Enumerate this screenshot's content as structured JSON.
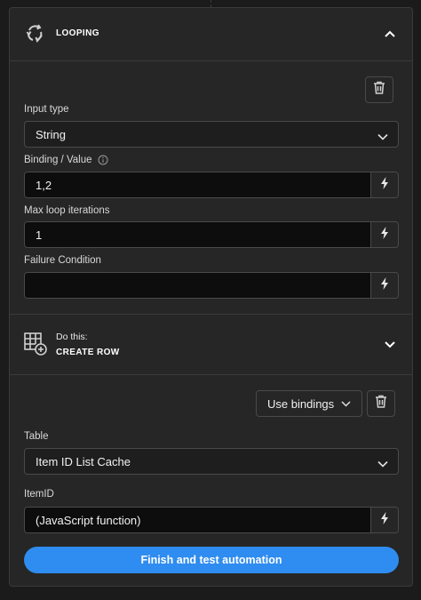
{
  "looping": {
    "title": "LOOPING",
    "icon": "loop-icon",
    "collapse_icon": "chevron-up-icon"
  },
  "loop_form": {
    "delete_icon": "trash-icon",
    "input_type": {
      "label": "Input type",
      "value": "String"
    },
    "binding_value": {
      "label": "Binding / Value",
      "value": "1,2",
      "info_icon": "info-icon"
    },
    "max_iterations": {
      "label": "Max loop iterations",
      "value": "1"
    },
    "failure_condition": {
      "label": "Failure Condition",
      "value": ""
    },
    "bolt_icon": "lightning-bolt-icon"
  },
  "step": {
    "eyebrow": "Do this:",
    "title": "CREATE ROW",
    "icon": "create-row-icon",
    "expand_icon": "chevron-down-icon"
  },
  "step_form": {
    "use_bindings_label": "Use bindings",
    "table": {
      "label": "Table",
      "value": "Item ID List Cache"
    },
    "item_id": {
      "label": "ItemID",
      "value": "(JavaScript function)"
    }
  },
  "footer": {
    "finish_label": "Finish and test automation"
  },
  "colors": {
    "accent": "#2f8cf0",
    "panel": "#262626",
    "field": "#0d0d0d",
    "border": "#4a4a4a"
  }
}
